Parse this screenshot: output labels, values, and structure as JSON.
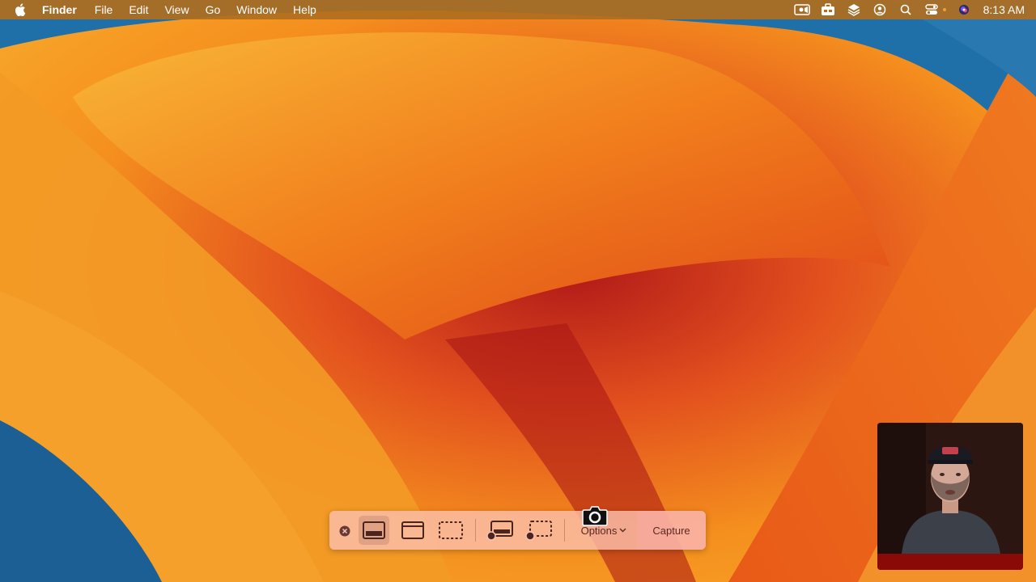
{
  "menubar": {
    "app_name": "Finder",
    "menus": [
      "File",
      "Edit",
      "View",
      "Go",
      "Window",
      "Help"
    ],
    "clock": "8:13 AM",
    "status_icons": [
      "screen-record-icon",
      "toolbox-icon",
      "layers-icon",
      "user-circle-icon",
      "search-icon",
      "control-center-icon",
      "siri-icon"
    ]
  },
  "screenshot_toolbar": {
    "options_label": "Options",
    "capture_label": "Capture",
    "buttons": [
      "close-icon",
      "capture-entire-screen-icon",
      "capture-window-icon",
      "capture-portion-icon",
      "record-entire-screen-icon",
      "record-portion-icon"
    ]
  },
  "colors": {
    "menubar": "#b06e1e",
    "wallpaper_orange": "#f08a1c",
    "wallpaper_red": "#c8281c",
    "wallpaper_blue": "#1f6fa8"
  }
}
